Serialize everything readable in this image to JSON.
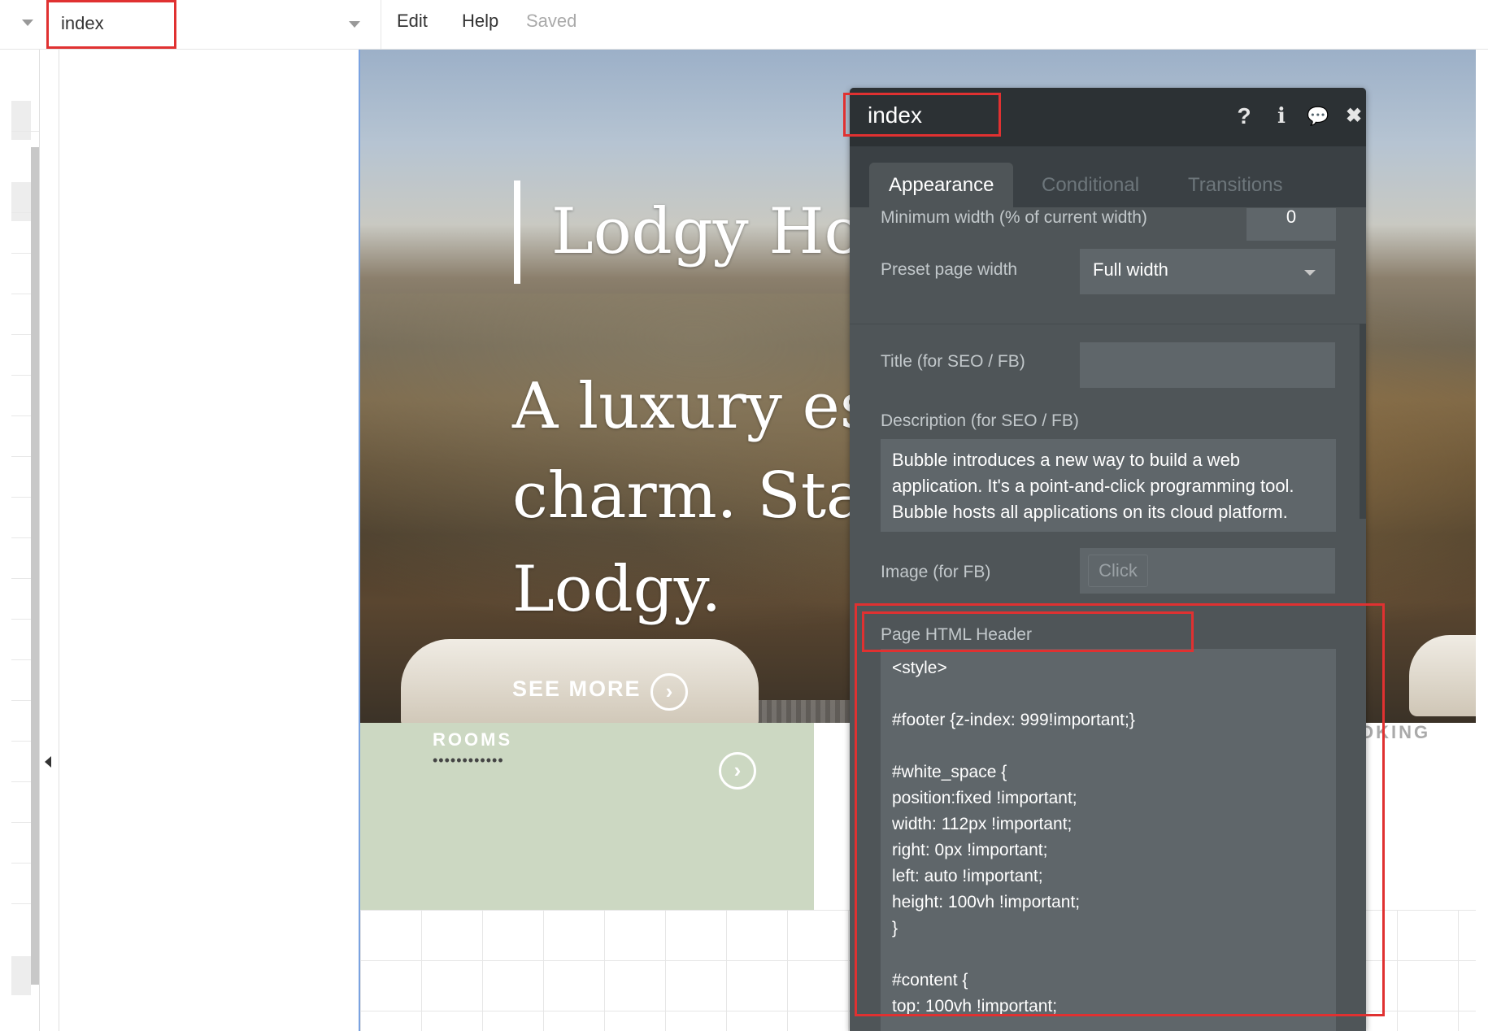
{
  "topbar": {
    "page_name": "index",
    "menu": {
      "edit": "Edit",
      "help": "Help",
      "status": "Saved"
    }
  },
  "canvas": {
    "title": "Lodgy Hot",
    "tagline_lines": [
      "A luxury es",
      "charm. Stay",
      "Lodgy."
    ],
    "see_more": "SEE MORE",
    "rooms_label": "ROOMS",
    "rooms_dots": "••••••••••••",
    "booking_label": "OKING",
    "circle_arrow": "›"
  },
  "editor": {
    "title": "index",
    "icons": [
      "help-icon",
      "info-icon",
      "comment-icon",
      "close-icon"
    ],
    "icon_glyphs": {
      "help": "?",
      "info": "i",
      "comment": "💬",
      "close": "✖"
    },
    "tabs": [
      {
        "label": "Appearance",
        "active": true
      },
      {
        "label": "Conditional",
        "active": false
      },
      {
        "label": "Transitions",
        "active": false
      }
    ],
    "min_width_label": "Minimum width (% of current width)",
    "min_width_value": "0",
    "preset_width_label": "Preset page width",
    "preset_width_value": "Full width",
    "seo_title_label": "Title (for SEO / FB)",
    "seo_title_value": "",
    "seo_desc_label": "Description (for SEO / FB)",
    "seo_desc_value": "Bubble introduces a new way to build a web application. It's a point-and-click programming tool. Bubble hosts all applications on its cloud platform.",
    "image_label": "Image (for FB)",
    "image_button": "Click",
    "html_header_label": "Page HTML Header",
    "html_header_lines": [
      "<style>",
      "",
      "#footer {z-index: 999!important;}",
      "",
      "#white_space {",
      "position:fixed !important;",
      "width: 112px !important;",
      "right: 0px !important;",
      "left: auto !important;",
      "height: 100vh !important;",
      "}",
      "",
      "#content {",
      "top: 100vh !important;"
    ]
  },
  "colors": {
    "highlight": "#e03131",
    "panel_bg": "#4f5558",
    "panel_header": "#2c3134",
    "rooms_bg": "#ccd8c2"
  }
}
